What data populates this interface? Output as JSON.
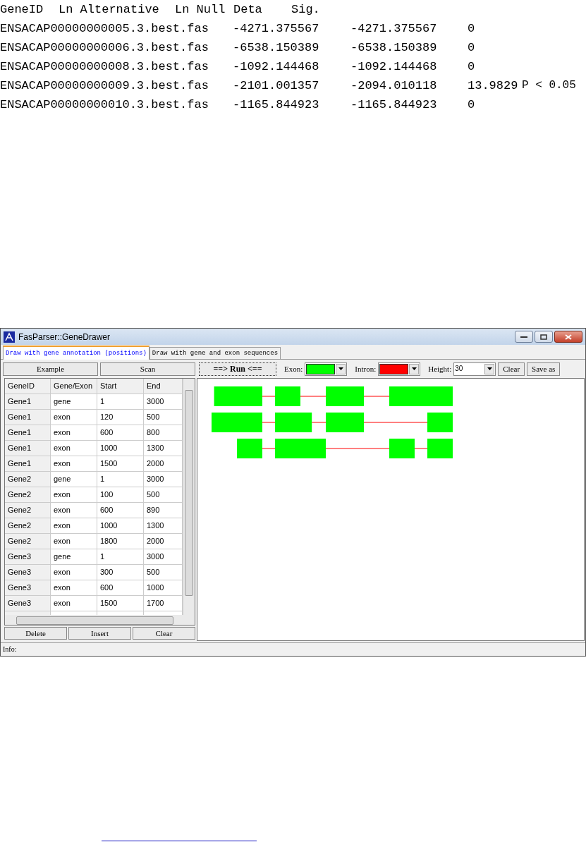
{
  "results": {
    "headers": [
      "GeneID",
      "Ln Alternative",
      "Ln Null",
      "Deta",
      "Sig."
    ],
    "rows": [
      {
        "gene_id": "ENSACAP00000000005.3.best.fas",
        "ln_alternative": "-4271.375567",
        "ln_null": "-4271.375567",
        "deta": "0"
      },
      {
        "gene_id": "ENSACAP00000000006.3.best.fas",
        "ln_alternative": "-6538.150389",
        "ln_null": "-6538.150389",
        "deta": "0"
      },
      {
        "gene_id": "ENSACAP00000000008.3.best.fas",
        "ln_alternative": "-1092.144468",
        "ln_null": "-1092.144468",
        "deta": "0"
      },
      {
        "gene_id": "ENSACAP00000000009.3.best.fas",
        "ln_alternative": "-2101.001357",
        "ln_null": "-2094.010118",
        "deta": "13.9829",
        "sig": "P < 0.05"
      },
      {
        "gene_id": "ENSACAP00000000010.3.best.fas",
        "ln_alternative": "-1165.844923",
        "ln_null": "-1165.844923",
        "deta": "0"
      }
    ]
  },
  "window": {
    "title": "FasParser::GeneDrawer",
    "tabs": [
      {
        "label": "Draw with gene annotation (positions)",
        "selected": true
      },
      {
        "label": "Draw with gene and exon sequences",
        "selected": false
      }
    ],
    "toolbar": {
      "buttons": [
        "Example",
        "Scan"
      ],
      "run_button": "==> Run <==",
      "pickers": [
        {
          "label": "Exon:",
          "color": "#00ff00"
        },
        {
          "label": "Intron:",
          "color": "#ff0000"
        }
      ],
      "height": {
        "label": "Height:",
        "value": "30"
      },
      "actions": [
        "Clear",
        "Save as"
      ]
    },
    "table": {
      "columns": [
        "GeneID",
        "Gene/Exon",
        "Start",
        "End"
      ],
      "rows": [
        [
          "Gene1",
          "gene",
          "1",
          "3000"
        ],
        [
          "Gene1",
          "exon",
          "120",
          "500"
        ],
        [
          "Gene1",
          "exon",
          "600",
          "800"
        ],
        [
          "Gene1",
          "exon",
          "1000",
          "1300"
        ],
        [
          "Gene1",
          "exon",
          "1500",
          "2000"
        ],
        [
          "Gene2",
          "gene",
          "1",
          "3000"
        ],
        [
          "Gene2",
          "exon",
          "100",
          "500"
        ],
        [
          "Gene2",
          "exon",
          "600",
          "890"
        ],
        [
          "Gene2",
          "exon",
          "1000",
          "1300"
        ],
        [
          "Gene2",
          "exon",
          "1800",
          "2000"
        ],
        [
          "Gene3",
          "gene",
          "1",
          "3000"
        ],
        [
          "Gene3",
          "exon",
          "300",
          "500"
        ],
        [
          "Gene3",
          "exon",
          "600",
          "1000"
        ],
        [
          "Gene3",
          "exon",
          "1500",
          "1700"
        ]
      ]
    },
    "table_buttons": [
      "Delete",
      "Insert",
      "Clear"
    ],
    "status_bar": "Info:"
  }
}
